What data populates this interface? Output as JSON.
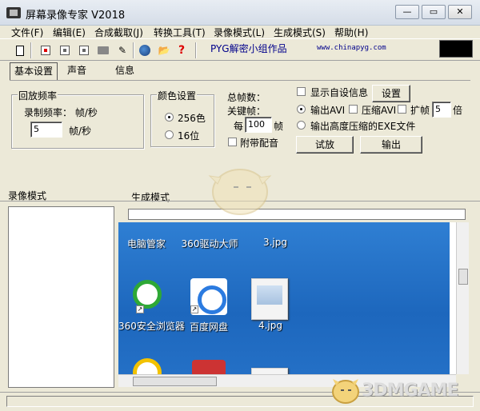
{
  "window": {
    "title": "屏幕录像专家 V2018"
  },
  "menu": [
    "文件(F)",
    "编辑(E)",
    "合成截取(J)",
    "转换工具(T)",
    "录像模式(L)",
    "生成模式(S)",
    "帮助(H)"
  ],
  "toolbar": {
    "credit": "PYG解密小组作品",
    "url": "www.chinapyg.com"
  },
  "tabs": [
    "基本设置",
    "声音",
    "信息"
  ],
  "playback": {
    "group_title": "回放频率",
    "rate_label": "录制频率： 帧/秒",
    "value": "5",
    "unit": "帧/秒"
  },
  "color": {
    "group_title": "颜色设置",
    "opt1": "256色",
    "opt2": "16位",
    "selected": "256色"
  },
  "frames": {
    "total_label": "总帧数：",
    "key_label": "关键帧：",
    "every": "每",
    "value": "100",
    "unit": "帧",
    "audio": "附带配音"
  },
  "options": {
    "show_custom": "显示自设信息",
    "setup": "设置",
    "out_avi": "输出AVI",
    "compress_avi": "压缩AVI",
    "expand": "扩帧",
    "expand_value": "5",
    "times": "倍",
    "out_exe": "输出高度压缩的EXE文件",
    "play": "试放",
    "output": "输出",
    "selected": "输出AVI"
  },
  "panes": {
    "record_mode": "录像模式",
    "generate_mode": "生成模式"
  },
  "desktop": {
    "items": [
      "电脑管家",
      "360驱动大师",
      "3.jpg",
      "360安全浏览器",
      "百度网盘",
      "4.jpg"
    ]
  },
  "watermark": {
    "text": "3DMGAME"
  }
}
